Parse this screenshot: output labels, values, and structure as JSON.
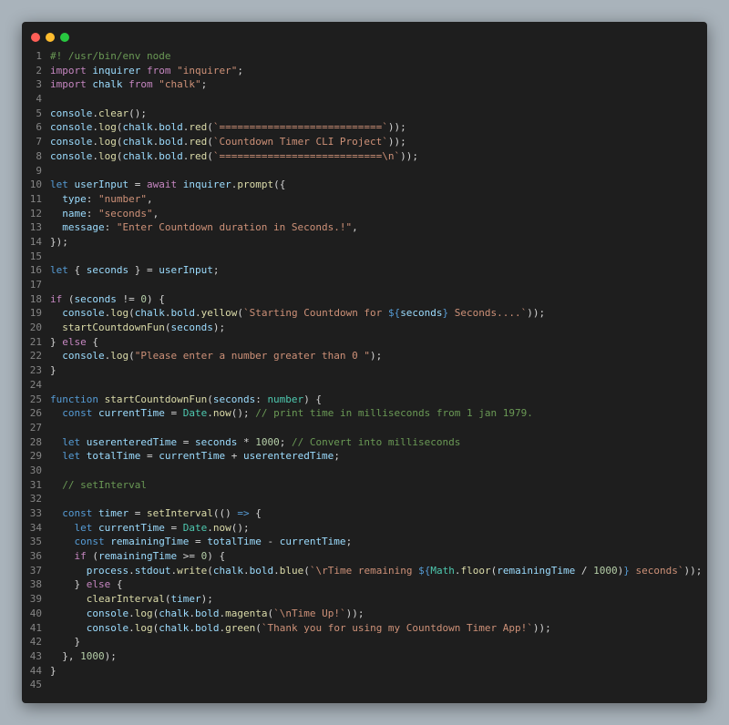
{
  "window": {
    "controls": [
      {
        "name": "close-button",
        "color": "#ff5f57"
      },
      {
        "name": "minimize-button",
        "color": "#febc2e"
      },
      {
        "name": "maximize-button",
        "color": "#28c840"
      }
    ]
  },
  "editor": {
    "lines": [
      [
        [
          "cmt",
          "#! /usr/bin/env node"
        ]
      ],
      [
        [
          "kw",
          "import "
        ],
        [
          "var",
          "inquirer"
        ],
        [
          "kw",
          " from "
        ],
        [
          "str",
          "\"inquirer\""
        ],
        [
          "pl",
          ";"
        ]
      ],
      [
        [
          "kw",
          "import "
        ],
        [
          "var",
          "chalk"
        ],
        [
          "kw",
          " from "
        ],
        [
          "str",
          "\"chalk\""
        ],
        [
          "pl",
          ";"
        ]
      ],
      [],
      [
        [
          "var",
          "console"
        ],
        [
          "pl",
          "."
        ],
        [
          "fn",
          "clear"
        ],
        [
          "pl",
          "();"
        ]
      ],
      [
        [
          "var",
          "console"
        ],
        [
          "pl",
          "."
        ],
        [
          "fn",
          "log"
        ],
        [
          "pl",
          "("
        ],
        [
          "var",
          "chalk"
        ],
        [
          "pl",
          "."
        ],
        [
          "var",
          "bold"
        ],
        [
          "pl",
          "."
        ],
        [
          "fn",
          "red"
        ],
        [
          "pl",
          "("
        ],
        [
          "str",
          "`===========================`"
        ],
        [
          "pl",
          "));"
        ]
      ],
      [
        [
          "var",
          "console"
        ],
        [
          "pl",
          "."
        ],
        [
          "fn",
          "log"
        ],
        [
          "pl",
          "("
        ],
        [
          "var",
          "chalk"
        ],
        [
          "pl",
          "."
        ],
        [
          "var",
          "bold"
        ],
        [
          "pl",
          "."
        ],
        [
          "fn",
          "red"
        ],
        [
          "pl",
          "("
        ],
        [
          "str",
          "`Countdown Timer CLI Project`"
        ],
        [
          "pl",
          "));"
        ]
      ],
      [
        [
          "var",
          "console"
        ],
        [
          "pl",
          "."
        ],
        [
          "fn",
          "log"
        ],
        [
          "pl",
          "("
        ],
        [
          "var",
          "chalk"
        ],
        [
          "pl",
          "."
        ],
        [
          "var",
          "bold"
        ],
        [
          "pl",
          "."
        ],
        [
          "fn",
          "red"
        ],
        [
          "pl",
          "("
        ],
        [
          "str",
          "`===========================\\n`"
        ],
        [
          "pl",
          "));"
        ]
      ],
      [],
      [
        [
          "kwb",
          "let "
        ],
        [
          "var",
          "userInput"
        ],
        [
          "pl",
          " = "
        ],
        [
          "kw",
          "await "
        ],
        [
          "var",
          "inquirer"
        ],
        [
          "pl",
          "."
        ],
        [
          "fn",
          "prompt"
        ],
        [
          "pl",
          "({"
        ]
      ],
      [
        [
          "var",
          "  type"
        ],
        [
          "pl",
          ": "
        ],
        [
          "str",
          "\"number\""
        ],
        [
          "pl",
          ","
        ]
      ],
      [
        [
          "var",
          "  name"
        ],
        [
          "pl",
          ": "
        ],
        [
          "str",
          "\"seconds\""
        ],
        [
          "pl",
          ","
        ]
      ],
      [
        [
          "var",
          "  message"
        ],
        [
          "pl",
          ": "
        ],
        [
          "str",
          "\"Enter Countdown duration in Seconds.!\""
        ],
        [
          "pl",
          ","
        ]
      ],
      [
        [
          "pl",
          "});"
        ]
      ],
      [],
      [
        [
          "kwb",
          "let "
        ],
        [
          "pl",
          "{ "
        ],
        [
          "var",
          "seconds"
        ],
        [
          "pl",
          " } = "
        ],
        [
          "var",
          "userInput"
        ],
        [
          "pl",
          ";"
        ]
      ],
      [],
      [
        [
          "kw",
          "if "
        ],
        [
          "pl",
          "("
        ],
        [
          "var",
          "seconds"
        ],
        [
          "pl",
          " != "
        ],
        [
          "num",
          "0"
        ],
        [
          "pl",
          ") {"
        ]
      ],
      [
        [
          "pl",
          "  "
        ],
        [
          "var",
          "console"
        ],
        [
          "pl",
          "."
        ],
        [
          "fn",
          "log"
        ],
        [
          "pl",
          "("
        ],
        [
          "var",
          "chalk"
        ],
        [
          "pl",
          "."
        ],
        [
          "var",
          "bold"
        ],
        [
          "pl",
          "."
        ],
        [
          "fn",
          "yellow"
        ],
        [
          "pl",
          "("
        ],
        [
          "str",
          "`Starting Countdown for "
        ],
        [
          "kwb",
          "${"
        ],
        [
          "var",
          "seconds"
        ],
        [
          "kwb",
          "}"
        ],
        [
          "str",
          " Seconds....`"
        ],
        [
          "pl",
          "));"
        ]
      ],
      [
        [
          "pl",
          "  "
        ],
        [
          "fn",
          "startCountdownFun"
        ],
        [
          "pl",
          "("
        ],
        [
          "var",
          "seconds"
        ],
        [
          "pl",
          ");"
        ]
      ],
      [
        [
          "pl",
          "} "
        ],
        [
          "kw",
          "else"
        ],
        [
          "pl",
          " {"
        ]
      ],
      [
        [
          "pl",
          "  "
        ],
        [
          "var",
          "console"
        ],
        [
          "pl",
          "."
        ],
        [
          "fn",
          "log"
        ],
        [
          "pl",
          "("
        ],
        [
          "str",
          "\"Please enter a number greater than 0 \""
        ],
        [
          "pl",
          ");"
        ]
      ],
      [
        [
          "pl",
          "}"
        ]
      ],
      [],
      [
        [
          "kwb",
          "function "
        ],
        [
          "fn",
          "startCountdownFun"
        ],
        [
          "pl",
          "("
        ],
        [
          "var",
          "seconds"
        ],
        [
          "pl",
          ": "
        ],
        [
          "ty",
          "number"
        ],
        [
          "pl",
          ") {"
        ]
      ],
      [
        [
          "pl",
          "  "
        ],
        [
          "kwb",
          "const "
        ],
        [
          "var",
          "currentTime"
        ],
        [
          "pl",
          " = "
        ],
        [
          "ty",
          "Date"
        ],
        [
          "pl",
          "."
        ],
        [
          "fn",
          "now"
        ],
        [
          "pl",
          "(); "
        ],
        [
          "cmt",
          "// print time in milliseconds from 1 jan 1979."
        ]
      ],
      [],
      [
        [
          "pl",
          "  "
        ],
        [
          "kwb",
          "let "
        ],
        [
          "var",
          "userenteredTime"
        ],
        [
          "pl",
          " = "
        ],
        [
          "var",
          "seconds"
        ],
        [
          "pl",
          " * "
        ],
        [
          "num",
          "1000"
        ],
        [
          "pl",
          "; "
        ],
        [
          "cmt",
          "// Convert into milliseconds"
        ]
      ],
      [
        [
          "pl",
          "  "
        ],
        [
          "kwb",
          "let "
        ],
        [
          "var",
          "totalTime"
        ],
        [
          "pl",
          " = "
        ],
        [
          "var",
          "currentTime"
        ],
        [
          "pl",
          " + "
        ],
        [
          "var",
          "userenteredTime"
        ],
        [
          "pl",
          ";"
        ]
      ],
      [],
      [
        [
          "cmt",
          "  // setInterval"
        ]
      ],
      [],
      [
        [
          "pl",
          "  "
        ],
        [
          "kwb",
          "const "
        ],
        [
          "var",
          "timer"
        ],
        [
          "pl",
          " = "
        ],
        [
          "fn",
          "setInterval"
        ],
        [
          "pl",
          "(() "
        ],
        [
          "kwb",
          "=>"
        ],
        [
          "pl",
          " {"
        ]
      ],
      [
        [
          "pl",
          "    "
        ],
        [
          "kwb",
          "let "
        ],
        [
          "var",
          "currentTime"
        ],
        [
          "pl",
          " = "
        ],
        [
          "ty",
          "Date"
        ],
        [
          "pl",
          "."
        ],
        [
          "fn",
          "now"
        ],
        [
          "pl",
          "();"
        ]
      ],
      [
        [
          "pl",
          "    "
        ],
        [
          "kwb",
          "const "
        ],
        [
          "var",
          "remainingTime"
        ],
        [
          "pl",
          " = "
        ],
        [
          "var",
          "totalTime"
        ],
        [
          "pl",
          " - "
        ],
        [
          "var",
          "currentTime"
        ],
        [
          "pl",
          ";"
        ]
      ],
      [
        [
          "pl",
          "    "
        ],
        [
          "kw",
          "if "
        ],
        [
          "pl",
          "("
        ],
        [
          "var",
          "remainingTime"
        ],
        [
          "pl",
          " >= "
        ],
        [
          "num",
          "0"
        ],
        [
          "pl",
          ") {"
        ]
      ],
      [
        [
          "pl",
          "      "
        ],
        [
          "var",
          "process"
        ],
        [
          "pl",
          "."
        ],
        [
          "var",
          "stdout"
        ],
        [
          "pl",
          "."
        ],
        [
          "fn",
          "write"
        ],
        [
          "pl",
          "("
        ],
        [
          "var",
          "chalk"
        ],
        [
          "pl",
          "."
        ],
        [
          "var",
          "bold"
        ],
        [
          "pl",
          "."
        ],
        [
          "fn",
          "blue"
        ],
        [
          "pl",
          "("
        ],
        [
          "str",
          "`\\rTime remaining "
        ],
        [
          "kwb",
          "${"
        ],
        [
          "ty",
          "Math"
        ],
        [
          "pl",
          "."
        ],
        [
          "fn",
          "floor"
        ],
        [
          "pl",
          "("
        ],
        [
          "var",
          "remainingTime"
        ],
        [
          "pl",
          " / "
        ],
        [
          "num",
          "1000"
        ],
        [
          "pl",
          ")"
        ],
        [
          "kwb",
          "}"
        ],
        [
          "str",
          " seconds`"
        ],
        [
          "pl",
          "));"
        ]
      ],
      [
        [
          "pl",
          "    } "
        ],
        [
          "kw",
          "else"
        ],
        [
          "pl",
          " {"
        ]
      ],
      [
        [
          "pl",
          "      "
        ],
        [
          "fn",
          "clearInterval"
        ],
        [
          "pl",
          "("
        ],
        [
          "var",
          "timer"
        ],
        [
          "pl",
          ");"
        ]
      ],
      [
        [
          "pl",
          "      "
        ],
        [
          "var",
          "console"
        ],
        [
          "pl",
          "."
        ],
        [
          "fn",
          "log"
        ],
        [
          "pl",
          "("
        ],
        [
          "var",
          "chalk"
        ],
        [
          "pl",
          "."
        ],
        [
          "var",
          "bold"
        ],
        [
          "pl",
          "."
        ],
        [
          "fn",
          "magenta"
        ],
        [
          "pl",
          "("
        ],
        [
          "str",
          "`\\nTime Up!`"
        ],
        [
          "pl",
          "));"
        ]
      ],
      [
        [
          "pl",
          "      "
        ],
        [
          "var",
          "console"
        ],
        [
          "pl",
          "."
        ],
        [
          "fn",
          "log"
        ],
        [
          "pl",
          "("
        ],
        [
          "var",
          "chalk"
        ],
        [
          "pl",
          "."
        ],
        [
          "var",
          "bold"
        ],
        [
          "pl",
          "."
        ],
        [
          "fn",
          "green"
        ],
        [
          "pl",
          "("
        ],
        [
          "str",
          "`Thank you for using my Countdown Timer App!`"
        ],
        [
          "pl",
          "));"
        ]
      ],
      [
        [
          "pl",
          "    }"
        ]
      ],
      [
        [
          "pl",
          "  }, "
        ],
        [
          "num",
          "1000"
        ],
        [
          "pl",
          ");"
        ]
      ],
      [
        [
          "pl",
          "}"
        ]
      ],
      []
    ]
  }
}
